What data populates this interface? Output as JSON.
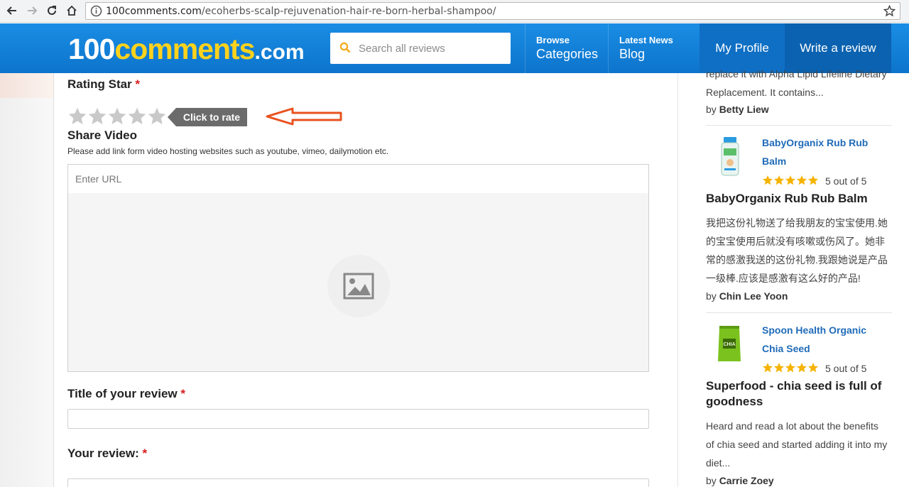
{
  "browser": {
    "url_host": "100comments.com",
    "url_path": "/ecoherbs-scalp-rejuvenation-hair-re-born-herbal-shampoo/"
  },
  "header": {
    "logo_part1": "100",
    "logo_part2": "comments",
    "logo_part3": ".com",
    "search_placeholder": "Search all reviews",
    "browse_small": "Browse",
    "browse_big": "Categories",
    "news_small": "Latest News",
    "news_big": "Blog",
    "profile": "My Profile",
    "write": "Write a review"
  },
  "form": {
    "rating_label": "Rating Star",
    "required_mark": "*",
    "rating_value": 0,
    "rating_max": 5,
    "click_to_rate": "Click to rate",
    "video_label": "Share Video",
    "video_help": "Please add link form video hosting websites such as youtube, vimeo, dailymotion etc.",
    "url_placeholder": "Enter URL",
    "title_label": "Title of your review",
    "review_label": "Your review:"
  },
  "sidebar": {
    "top_excerpt": "replace it with Alpha Lipid Lifeline Dietary Replacement. It contains...",
    "top_by_prefix": "by",
    "top_author": "Betty Liew",
    "reviews": [
      {
        "product": "BabyOrganix Rub Rub Balm",
        "score_text": "5 out of 5",
        "rating": 5,
        "title": "BabyOrganix Rub Rub Balm",
        "excerpt": "我把这份礼物送了给我朋友的宝宝使用.她的宝宝使用后就没有咳嗽或伤风了。她非常的感激我送的这份礼物.我跟她说是产品一级棒.应该是感激有这么好的产品!",
        "by_prefix": "by",
        "author": "Chin Lee Yoon"
      },
      {
        "product": "Spoon Health Organic Chia Seed",
        "score_text": "5 out of 5",
        "rating": 5,
        "title": "Superfood - chia seed is full of goodness",
        "excerpt": "Heard and read a lot about the benefits of chia seed and started adding it into my diet...",
        "by_prefix": "by",
        "author": "Carrie Zoey"
      }
    ]
  },
  "colors": {
    "header_blue": "#0d74cc",
    "logo_yellow": "#ffd21c",
    "required_red": "#d91c1c",
    "link_blue": "#1f6bb8",
    "star_gold": "#f5b301",
    "arrow_orange": "#e8521f"
  }
}
